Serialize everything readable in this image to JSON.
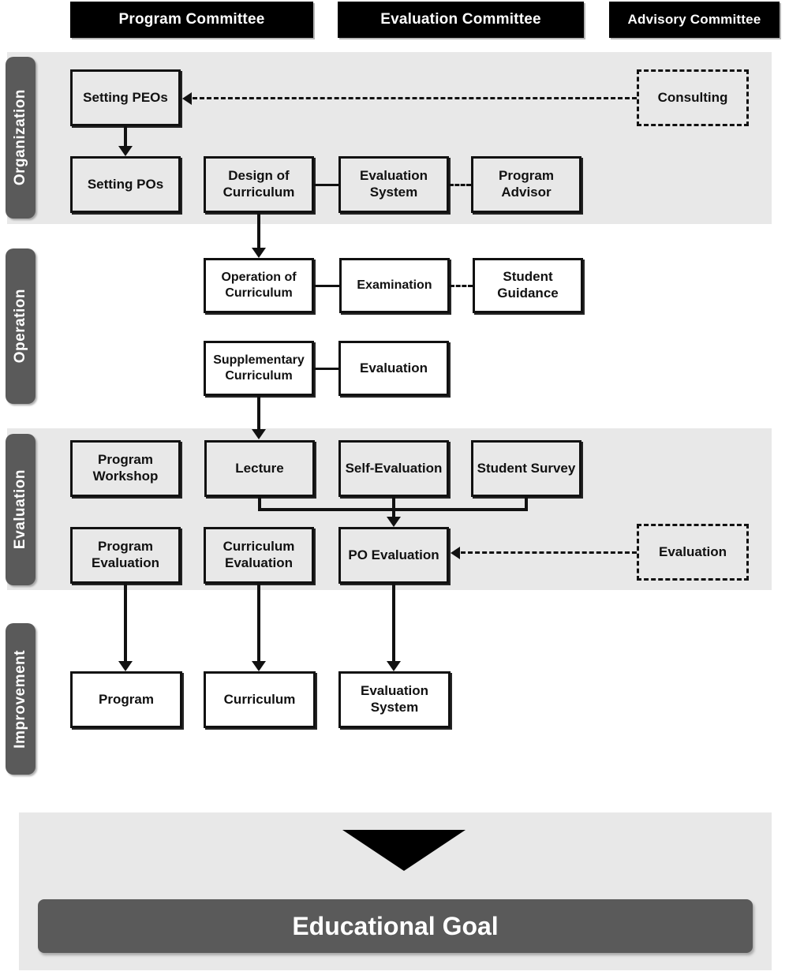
{
  "headers": [
    {
      "label": "Program Committee"
    },
    {
      "label": "Evaluation Committee"
    },
    {
      "label": "Advisory Committee"
    }
  ],
  "phases": [
    {
      "label": "Organization"
    },
    {
      "label": "Operation"
    },
    {
      "label": "Evaluation"
    },
    {
      "label": "Improvement"
    }
  ],
  "nodes": {
    "setting_peos": "Setting PEOs",
    "consulting": "Consulting",
    "setting_pos": "Setting POs",
    "design_of_curriculum": "Design of Curriculum",
    "evaluation_system_org": "Evaluation System",
    "program_advisor": "Program Advisor",
    "operation_of_curriculum": "Operation of Curriculum",
    "examination": "Examination",
    "student_guidance": "Student Guidance",
    "supplementary_curriculum": "Supplementary Curriculum",
    "evaluation_supp": "Evaluation",
    "program_workshop": "Program Workshop",
    "lecture": "Lecture",
    "self_evaluation": "Self-Evaluation",
    "student_survey": "Student Survey",
    "program_evaluation": "Program Evaluation",
    "curriculum_evaluation": "Curriculum Evaluation",
    "po_evaluation": "PO Evaluation",
    "evaluation_advisory": "Evaluation",
    "program": "Program",
    "curriculum": "Curriculum",
    "evaluation_system_imp": "Evaluation System"
  },
  "goal": {
    "label": "Educational Goal"
  },
  "colors": {
    "header_bar": "#000000",
    "band": "#e8e8e8",
    "phase_label": "#5a5a5a",
    "goal_bar": "#5a5a5a",
    "node_border": "#111111",
    "text_light": "#ffffff",
    "text_dark": "#111111"
  }
}
